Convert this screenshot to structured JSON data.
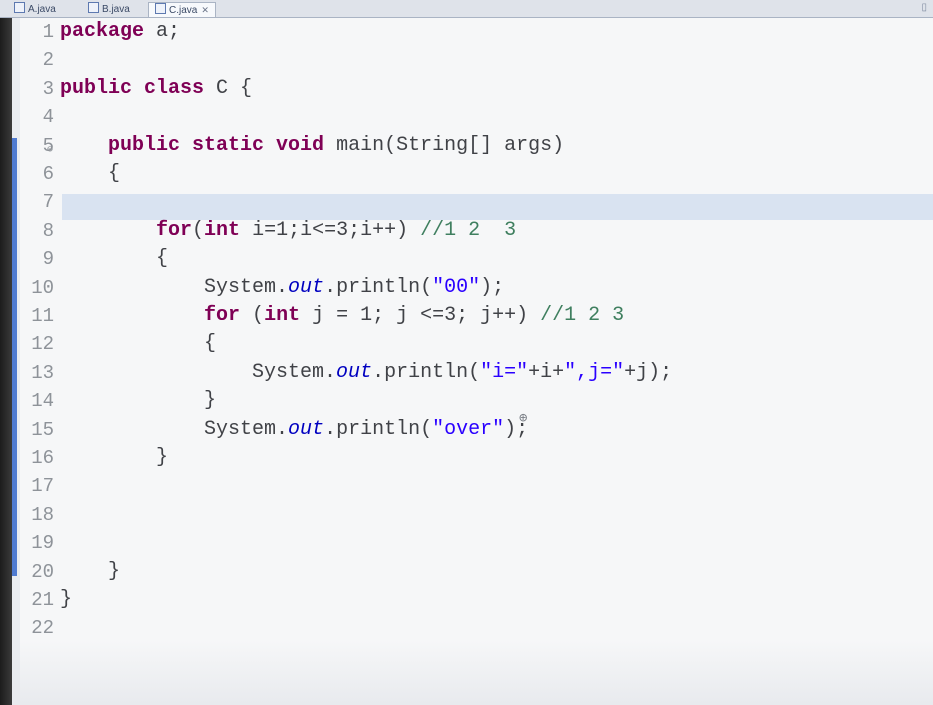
{
  "tabs": [
    {
      "label": "A.java",
      "active": false
    },
    {
      "label": "B.java",
      "active": false
    },
    {
      "label": "C.java",
      "active": true,
      "close_label": "✕"
    }
  ],
  "editor": {
    "current_line": 7,
    "lines": [
      {
        "n": "1",
        "t": "<span class='kw'>package</span> a;"
      },
      {
        "n": "2",
        "t": ""
      },
      {
        "n": "3",
        "t": "<span class='kw'>public class</span> C {"
      },
      {
        "n": "4",
        "t": ""
      },
      {
        "n": "5",
        "t": "    <span class='kw'>public static void</span> main(String[] args)"
      },
      {
        "n": "6",
        "t": "    {"
      },
      {
        "n": "7",
        "t": ""
      },
      {
        "n": "8",
        "t": "        <span class='kw'>for</span>(<span class='kw'>int</span> i=1;i<=3;i++) <span class='cmt'>//1 2  3</span>"
      },
      {
        "n": "9",
        "t": "        {"
      },
      {
        "n": "10",
        "t": "            System.<span class='fld'>out</span>.println(<span class='str'>\"00\"</span>);"
      },
      {
        "n": "11",
        "t": "            <span class='kw'>for</span> (<span class='kw'>int</span> j = 1; j <=3; j++) <span class='cmt'>//1 2 3</span>"
      },
      {
        "n": "12",
        "t": "            {"
      },
      {
        "n": "13",
        "t": "                System.<span class='fld'>out</span>.println(<span class='str'>\"i=\"</span>+i+<span class='str'>\",j=\"</span>+j);"
      },
      {
        "n": "14",
        "t": "            }"
      },
      {
        "n": "15",
        "t": "            System.<span class='fld'>out</span>.println(<span class='str'>\"over\"</span>);"
      },
      {
        "n": "16",
        "t": "        }"
      },
      {
        "n": "17",
        "t": ""
      },
      {
        "n": "18",
        "t": ""
      },
      {
        "n": "19",
        "t": ""
      },
      {
        "n": "20",
        "t": "    }"
      },
      {
        "n": "21",
        "t": "}"
      },
      {
        "n": "22",
        "t": ""
      }
    ]
  },
  "icons": {
    "fold": "collapse-marker-icon",
    "cursor": "magnifier-cursor-icon"
  }
}
